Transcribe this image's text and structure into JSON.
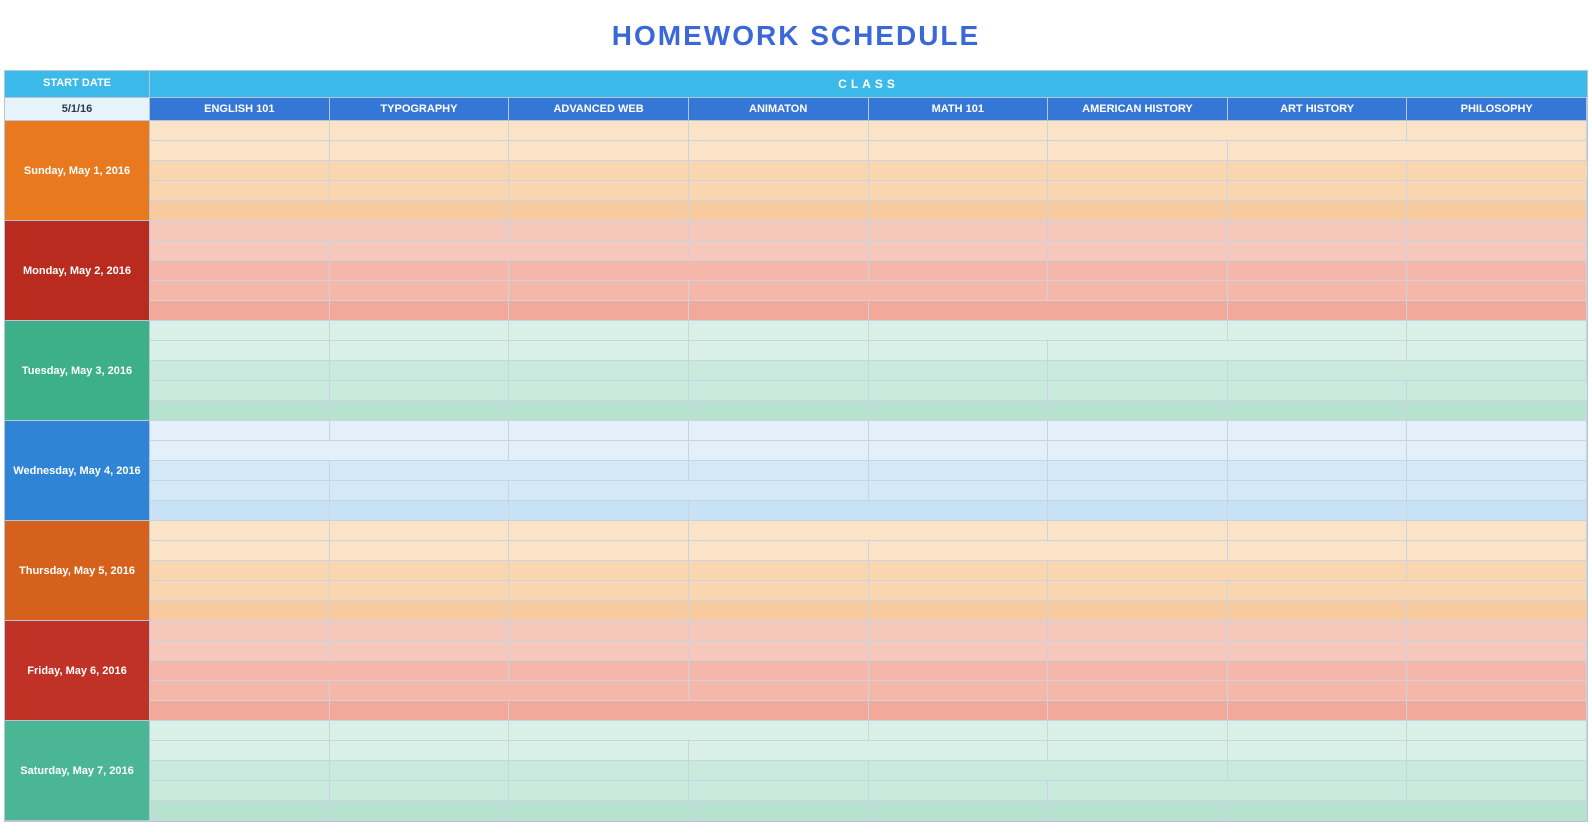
{
  "title": "HOMEWORK SCHEDULE",
  "header": {
    "start_date_label": "START DATE",
    "class_label": "CLASS",
    "date_value": "5/1/16"
  },
  "classes": [
    "ENGLISH 101",
    "TYPOGRAPHY",
    "ADVANCED WEB",
    "ANIMATON",
    "MATH 101",
    "AMERICAN HISTORY",
    "ART HISTORY",
    "PHILOSOPHY"
  ],
  "days": [
    {
      "label": "Sunday, May 1, 2016",
      "color": "c-orange",
      "tints": [
        "t-peach1",
        "t-peach1",
        "t-peach2",
        "t-peach2",
        "t-peach3"
      ]
    },
    {
      "label": "Monday, May 2, 2016",
      "color": "c-red",
      "tints": [
        "t-salmon1",
        "t-salmon1",
        "t-salmon2",
        "t-salmon2",
        "t-salmon3"
      ]
    },
    {
      "label": "Tuesday, May 3, 2016",
      "color": "c-teal",
      "tints": [
        "t-mint1",
        "t-mint1",
        "t-mint2",
        "t-mint2",
        "t-mint3"
      ]
    },
    {
      "label": "Wednesday, May 4, 2016",
      "color": "c-blue",
      "tints": [
        "t-sky1",
        "t-sky1",
        "t-sky2",
        "t-sky2",
        "t-sky3"
      ]
    },
    {
      "label": "Thursday, May 5, 2016",
      "color": "c-orange2",
      "tints": [
        "t-peach1",
        "t-peach1",
        "t-peach2",
        "t-peach2",
        "t-peach3"
      ]
    },
    {
      "label": "Friday, May 6, 2016",
      "color": "c-red2",
      "tints": [
        "t-salmon1",
        "t-salmon1",
        "t-salmon2",
        "t-salmon2",
        "t-salmon3"
      ]
    },
    {
      "label": "Saturday, May 7, 2016",
      "color": "c-teal2",
      "tints": [
        "t-mint1",
        "t-mint1",
        "t-mint2",
        "t-mint2",
        "t-mint3"
      ]
    }
  ],
  "rows_per_day": 5
}
